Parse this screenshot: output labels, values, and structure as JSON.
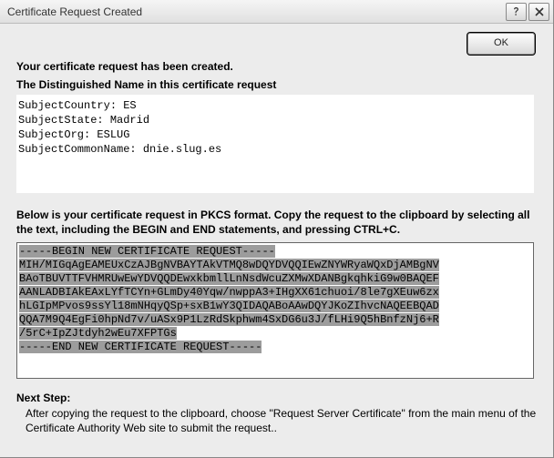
{
  "window": {
    "title": "Certificate Request Created"
  },
  "buttons": {
    "ok": "OK"
  },
  "intro": "Your certificate request has been created.",
  "dn": {
    "heading": "The Distinguished Name in this certificate request",
    "lines": {
      "country": "SubjectCountry: ES",
      "state": "SubjectState: Madrid",
      "org": "SubjectOrg: ESLUG",
      "commonName": "SubjectCommonName: dnie.slug.es"
    }
  },
  "pkcs": {
    "blurb": "Below is your certificate request in PKCS format.  Copy the request to the clipboard by selecting all the text, including the BEGIN and END statements, and pressing CTRL+C.",
    "lines": {
      "l1": "-----BEGIN NEW CERTIFICATE REQUEST-----",
      "l2": "MIH/MIGqAgEAMEUxCzAJBgNVBAYTAkVTMQ8wDQYDVQQIEwZNYWRyaWQxDjAMBgNV",
      "l3": "BAoTBUVTTFVHMRUwEwYDVQQDEwxkbmllLnNsdWcuZXMwXDANBgkqhkiG9w0BAQEF",
      "l4": "AANLADBIAkEAxLYfTCYn+GLmDy40Yqw/nwppA3+IHgXX61chuoi/8le7gXEuw6zx",
      "l5": "hLGIpMPvos9ssYl18mNHqyQSp+sxB1wY3QIDAQABoAAwDQYJKoZIhvcNAQEEBQAD",
      "l6": "QQA7M9Q4EgFi0hpNd7v/uASx9P1LzRdSkphwm4SxDG6u3J/fLHi9Q5hBnfzNj6+R",
      "l7": "/5rC+IpZJtdyh2wEu7XFPTGs",
      "l8": "-----END NEW CERTIFICATE REQUEST-----"
    }
  },
  "next": {
    "heading": "Next Step:",
    "body": "After copying the request to the clipboard, choose \"Request Server Certificate\" from the main menu of the Certificate Authority Web site to submit the request.."
  }
}
